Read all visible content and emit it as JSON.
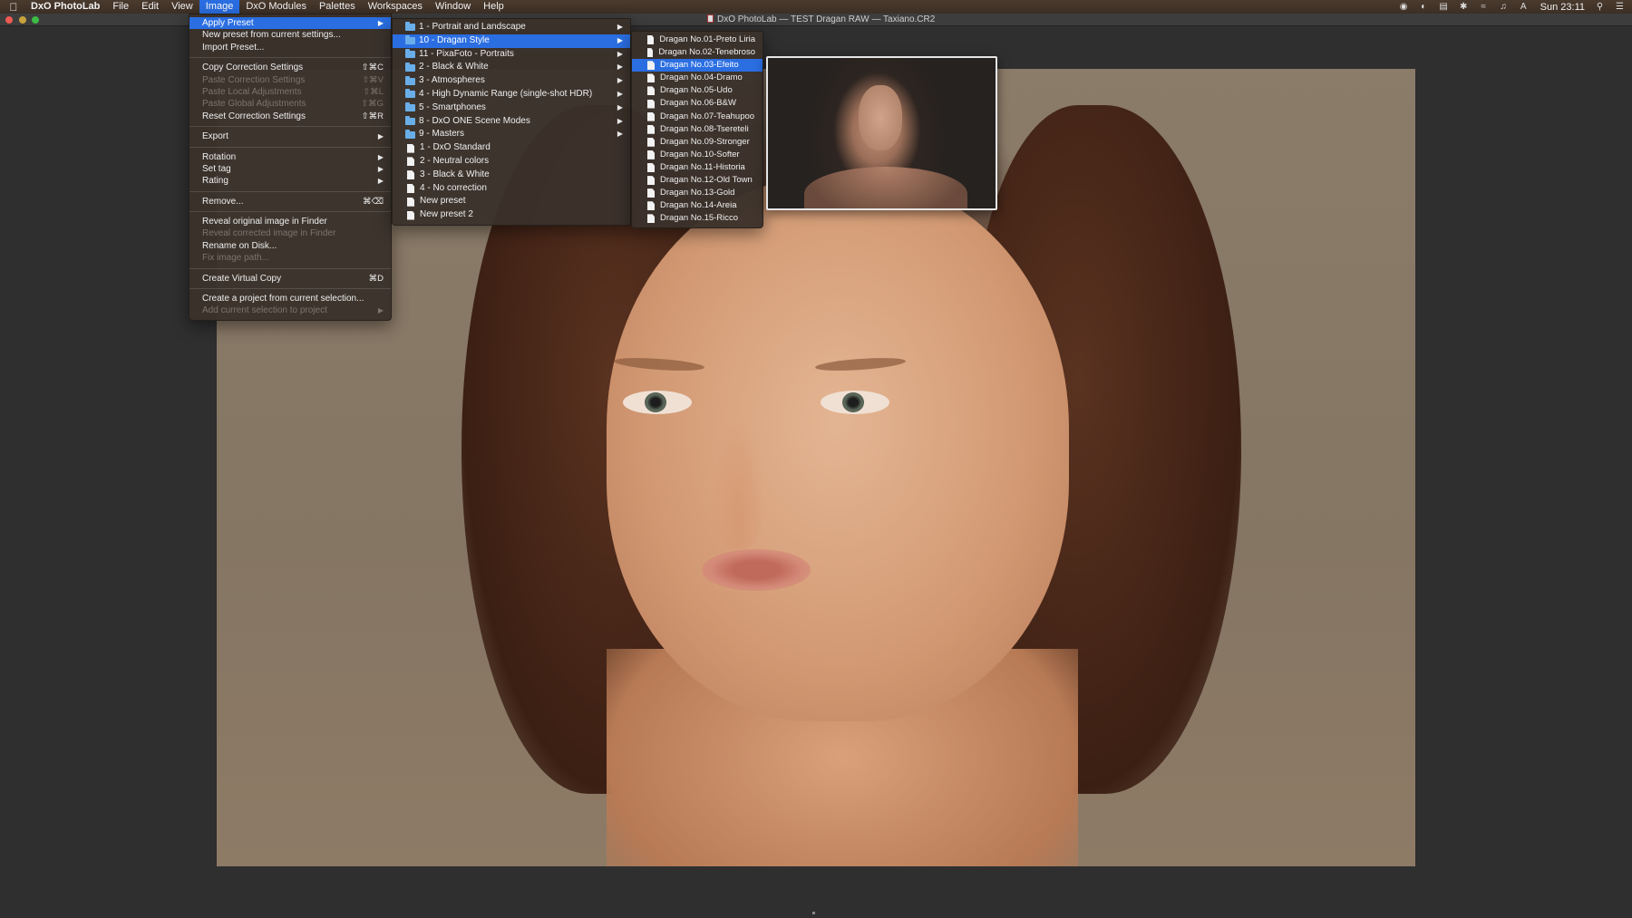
{
  "menubar": {
    "app": "DxO PhotoLab",
    "items": [
      "File",
      "Edit",
      "View",
      "Image",
      "DxO Modules",
      "Palettes",
      "Workspaces",
      "Window",
      "Help"
    ],
    "active": "Image",
    "clock": "Sun 23:11"
  },
  "window": {
    "title": "DxO PhotoLab — TEST Dragan RAW — Taxiano.CR2"
  },
  "image_menu": {
    "items": [
      {
        "label": "Apply Preset",
        "shortcut": "",
        "submenu": true,
        "disabled": false,
        "highlight": true
      },
      {
        "label": "New preset from current settings...",
        "shortcut": "",
        "submenu": false,
        "disabled": false
      },
      {
        "label": "Import Preset...",
        "shortcut": "",
        "submenu": false,
        "disabled": false
      },
      {
        "label": "Copy Correction Settings",
        "shortcut": "⇧⌘C",
        "submenu": false,
        "disabled": false
      },
      {
        "label": "Paste Correction Settings",
        "shortcut": "⇧⌘V",
        "submenu": false,
        "disabled": true
      },
      {
        "label": "Paste Local Adjustments",
        "shortcut": "⇧⌘L",
        "submenu": false,
        "disabled": true
      },
      {
        "label": "Paste Global Adjustments",
        "shortcut": "⇧⌘G",
        "submenu": false,
        "disabled": true
      },
      {
        "label": "Reset Correction Settings",
        "shortcut": "⇧⌘R",
        "submenu": false,
        "disabled": false
      },
      {
        "label": "Export",
        "shortcut": "",
        "submenu": true,
        "disabled": false
      },
      {
        "label": "Rotation",
        "shortcut": "",
        "submenu": true,
        "disabled": false
      },
      {
        "label": "Set tag",
        "shortcut": "",
        "submenu": true,
        "disabled": false
      },
      {
        "label": "Rating",
        "shortcut": "",
        "submenu": true,
        "disabled": false
      },
      {
        "label": "Remove...",
        "shortcut": "⌘⌫",
        "submenu": false,
        "disabled": false
      },
      {
        "label": "Reveal original image in Finder",
        "shortcut": "",
        "submenu": false,
        "disabled": false
      },
      {
        "label": "Reveal corrected image in Finder",
        "shortcut": "",
        "submenu": false,
        "disabled": true
      },
      {
        "label": "Rename on Disk...",
        "shortcut": "",
        "submenu": false,
        "disabled": false
      },
      {
        "label": "Fix image path...",
        "shortcut": "",
        "submenu": false,
        "disabled": true
      },
      {
        "label": "Create Virtual Copy",
        "shortcut": "⌘D",
        "submenu": false,
        "disabled": false
      },
      {
        "label": "Create a project from current selection...",
        "shortcut": "",
        "submenu": false,
        "disabled": false
      },
      {
        "label": "Add current selection to project",
        "shortcut": "",
        "submenu": true,
        "disabled": true
      }
    ]
  },
  "preset_menu": {
    "items": [
      {
        "label": "1 - Portrait and Landscape",
        "type": "folder"
      },
      {
        "label": "10 - Dragan Style",
        "type": "folder",
        "highlight": true
      },
      {
        "label": "11 - PixaFoto - Portraits",
        "type": "folder"
      },
      {
        "label": "2 - Black & White",
        "type": "folder"
      },
      {
        "label": "3 - Atmospheres",
        "type": "folder"
      },
      {
        "label": "4 - High Dynamic Range (single-shot HDR)",
        "type": "folder"
      },
      {
        "label": "5 - Smartphones",
        "type": "folder"
      },
      {
        "label": "8 - DxO ONE Scene Modes",
        "type": "folder"
      },
      {
        "label": "9 - Masters",
        "type": "folder"
      },
      {
        "label": "1 - DxO Standard",
        "type": "file"
      },
      {
        "label": "2 - Neutral colors",
        "type": "file"
      },
      {
        "label": "3 - Black & White",
        "type": "file"
      },
      {
        "label": "4 - No correction",
        "type": "file"
      },
      {
        "label": "New preset",
        "type": "file"
      },
      {
        "label": "New preset 2",
        "type": "file"
      }
    ]
  },
  "dragan_menu": {
    "items": [
      {
        "label": "Dragan No.01-Preto Liria"
      },
      {
        "label": "Dragan No.02-Tenebroso"
      },
      {
        "label": "Dragan No.03-Efeito",
        "highlight": true
      },
      {
        "label": "Dragan No.04-Dramo"
      },
      {
        "label": "Dragan No.05-Udo"
      },
      {
        "label": "Dragan No.06-B&W"
      },
      {
        "label": "Dragan No.07-Teahupoo"
      },
      {
        "label": "Dragan No.08-Tsereteli"
      },
      {
        "label": "Dragan No.09-Stronger"
      },
      {
        "label": "Dragan No.10-Softer"
      },
      {
        "label": "Dragan No.11-Historia"
      },
      {
        "label": "Dragan No.12-Old Town"
      },
      {
        "label": "Dragan No.13-Gold"
      },
      {
        "label": "Dragan No.14-Areia"
      },
      {
        "label": "Dragan No.15-Ricco"
      }
    ]
  },
  "colors": {
    "highlight": "#2a6ee2",
    "menu_bg": "#3a312b",
    "app_bg": "#2f2f2f"
  }
}
